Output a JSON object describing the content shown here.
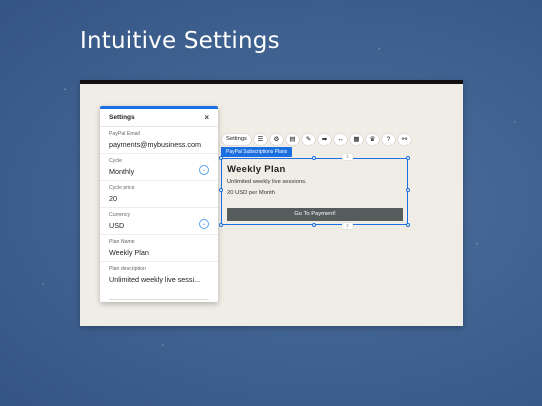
{
  "slide": {
    "title": "Intuitive Settings"
  },
  "settings_panel": {
    "title": "Settings",
    "close_glyph": "×",
    "fields": [
      {
        "label": "PayPal Email",
        "value": "payments@mybusiness.com"
      },
      {
        "label": "Cycle",
        "value": "Monthly"
      },
      {
        "label": "Cycle price",
        "value": "20"
      },
      {
        "label": "Currency",
        "value": "USD"
      },
      {
        "label": "Plan Name",
        "value": "Weekly Plan"
      },
      {
        "label": "Plan description",
        "value": "Unlimited weekly live sessi..."
      }
    ],
    "dropdown_glyph": "⌄"
  },
  "toolbar": {
    "settings_label": "Settings",
    "icons": [
      "list-icon",
      "gear-icon",
      "layout-icon",
      "pen-icon",
      "arrows-icon",
      "resize-icon",
      "grid-icon",
      "crown-icon",
      "help-icon",
      "link-icon"
    ]
  },
  "widget": {
    "tag": "PayPal Subscriptions Plans",
    "title": "Weekly Plan",
    "description": "Unlimited weekly live sessions.",
    "price": "20 USD per Month",
    "button_label": "Go To Payment!",
    "anchor_glyph": "⇳"
  },
  "colors": {
    "accent": "#1c6fe0",
    "button": "#555c5c",
    "canvas": "#f0ede6",
    "background": "#3f6190"
  }
}
